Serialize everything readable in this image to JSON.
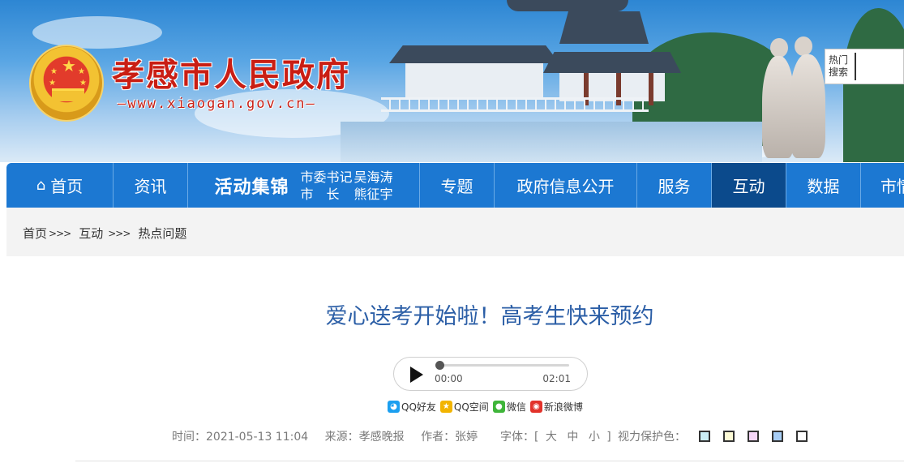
{
  "header": {
    "site_title": "孝感市人民政府",
    "site_url": "—www.xiaogan.gov.cn—",
    "search": {
      "hot_label": "热门搜索"
    }
  },
  "nav": {
    "items": [
      {
        "label": "首页",
        "icon": "home-icon"
      },
      {
        "label": "资讯"
      },
      {
        "label": "活动集锦",
        "roles": [
          "市委书记",
          "市长"
        ],
        "names": [
          "吴海涛",
          "熊征宇"
        ]
      },
      {
        "label": "专题"
      },
      {
        "label": "政府信息公开"
      },
      {
        "label": "服务"
      },
      {
        "label": "互动",
        "active": true
      },
      {
        "label": "数据"
      },
      {
        "label": "市情"
      }
    ],
    "colors": {
      "bar": "#1c78d2",
      "active": "#0b4a8c"
    }
  },
  "breadcrumb": [
    "首页",
    "互动",
    "热点问题"
  ],
  "breadcrumb_separator": ">>>",
  "article": {
    "title": "爱心送考开始啦！高考生快来预约",
    "audio": {
      "current": "00:00",
      "duration": "02:01",
      "progress": 0
    },
    "share": [
      {
        "label": "QQ好友",
        "icon": "qq-icon"
      },
      {
        "label": "QQ空间",
        "icon": "qzone-icon"
      },
      {
        "label": "微信",
        "icon": "wechat-icon"
      },
      {
        "label": "新浪微博",
        "icon": "weibo-icon"
      }
    ],
    "meta": {
      "time": "时间：2021-05-13 11:04",
      "source": "来源：孝感晚报",
      "author": "作者：张婷"
    },
    "font_size": {
      "label": "字体：[",
      "sizes": [
        "大",
        "中",
        "小"
      ],
      "close": "]"
    },
    "vision": {
      "label": "视力保护色：",
      "swatches": [
        "#cbeef7",
        "#fdfbd6",
        "#f6d6f8",
        "#a7cdf5",
        "#ffffff"
      ]
    }
  }
}
